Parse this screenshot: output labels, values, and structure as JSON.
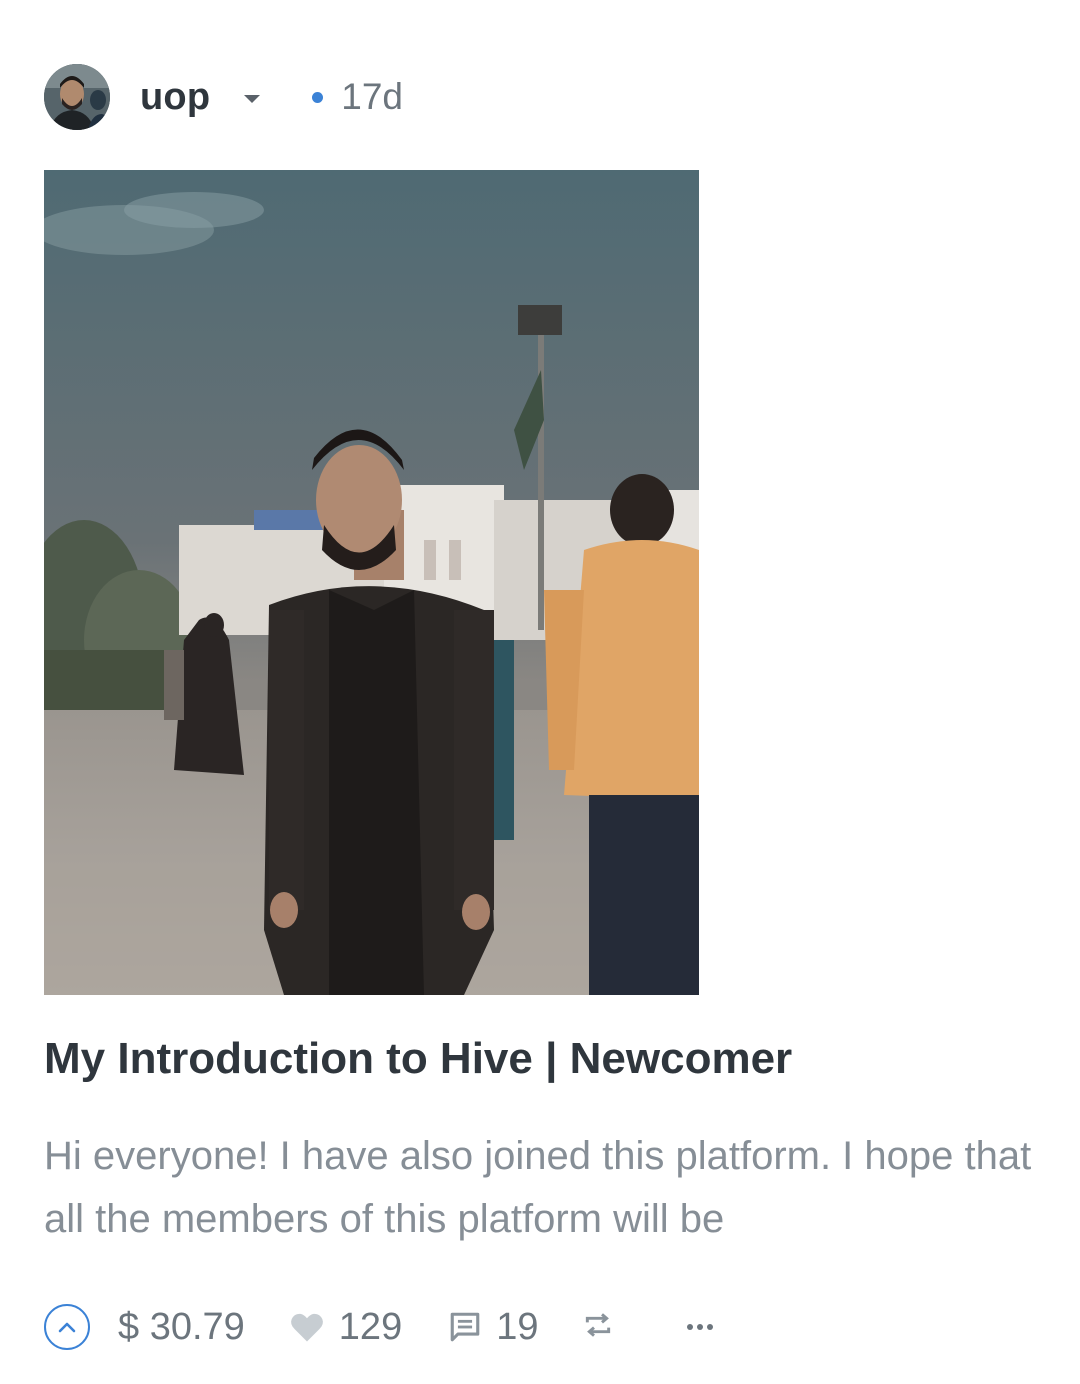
{
  "post": {
    "author": "uop",
    "time_ago": "17d",
    "title": "My Introduction to Hive | Newcomer",
    "excerpt": "Hi everyone! I have also joined this platform. I hope that all the members of this platform will be",
    "payout": "$ 30.79",
    "likes": "129",
    "comments": "19"
  },
  "colors": {
    "accent": "#3b82d6",
    "title": "#2f363d",
    "muted": "#868e96"
  },
  "icons": {
    "author_menu": "chevron-down-icon",
    "upvote": "upvote-chevron-icon",
    "likes": "heart-icon",
    "comments": "comment-icon",
    "reblog": "reblog-icon",
    "more": "more-dots-icon"
  }
}
